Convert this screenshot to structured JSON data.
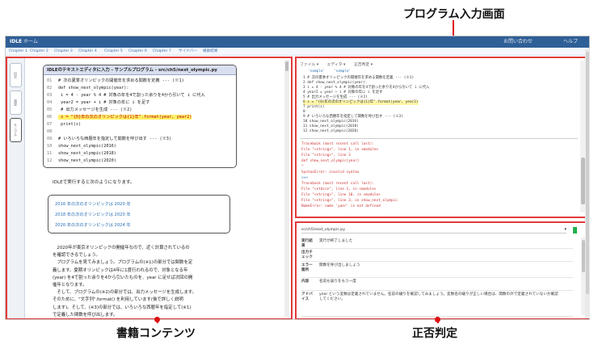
{
  "callouts": {
    "program_input": "プログラム入力画面",
    "book_content": "書籍コンテンツ",
    "judgement": "正否判定"
  },
  "topbar": {
    "logo": "IDLE",
    "title": "ホーム",
    "right1": "お問い合わせ",
    "right2": "ヘルプ"
  },
  "chapters": [
    "Chapter 1",
    "Chapter 2",
    "Chapter 3",
    "Chapter 4",
    "Chapter 5",
    "Chapter 6",
    "Chapter 7",
    "サイドバー",
    "検索結果"
  ],
  "sidetabs": [
    "目次",
    "演習",
    "サンプル"
  ],
  "code": {
    "title": "IDLEのテキストエディタに入力 - サンプルプログラム - src/ch5/next_olympic.py",
    "lines": [
      {
        "n": "01",
        "t": "# 次の夏季オリンピックの開催年を求める関数を定義 --- (※1)",
        "hl": false
      },
      {
        "n": "02",
        "t": "def show_next_olympic(year):",
        "hl": false
      },
      {
        "n": "03",
        "t": "    i = 4 - year % 4  # 対象の年を4で割った余りを4から引いて i に代入",
        "hl": false
      },
      {
        "n": "04",
        "t": "    year2 = year + i  # 対象の年に i を足す",
        "hl": false
      },
      {
        "n": "05",
        "t": "    # 出力メッセージを生成 --- (※2)",
        "hl": false
      },
      {
        "n": "06",
        "t": "    s = \"{0}年の次のオリンピックは{1}年\".format(year, year2)",
        "hl": true
      },
      {
        "n": "07",
        "t": "    print(s)",
        "hl": false
      },
      {
        "n": "08",
        "t": "",
        "hl": false
      },
      {
        "n": "09",
        "t": "# いろいろな西暦年を指定して関数を呼び出す --- (※3)",
        "hl": false
      },
      {
        "n": "10",
        "t": "show_next_olympic(2016)",
        "hl": false
      },
      {
        "n": "11",
        "t": "show_next_olympic(2018)",
        "hl": false
      },
      {
        "n": "12",
        "t": "show_next_olympic(2020)",
        "hl": false
      }
    ]
  },
  "run_text": "IDLEで実行すると次のようになります。",
  "output_lines": [
    "2016 年の次のオリンピックは 2020 年",
    "2018 年の次のオリンピックは 2020 年",
    "2020 年の次のオリンピックは 2024 年"
  ],
  "body_lines": [
    "　2020年が東京オリンピックの開催年なので、近く計算されているの",
    "を確認できるでしょう。",
    "　プログラムを見てみましょう。プログラムの(※1)の部分では関数を定",
    "義します。夏期オリンピックは4年に1度行われるので、対象となる年",
    "(year) を4で割った余りを4から引いたものを、year に足せば次回の開",
    "催年となります。",
    "　そして、プログラムの(※2)の部分では、出力メッセージを生成します。",
    "そのために、\"文字列\".format() を利用しています(後で詳しく説明",
    "します)。そして、(※3)の部分では、いろいろな西暦年を指定して(※1)",
    "で定義した関数を呼び出します。"
  ],
  "editor": {
    "toolbar": [
      "ファイル ▾",
      "エディタ ▾",
      "正否判定 ▾"
    ],
    "header": [
      "'sample'",
      "'sample'"
    ],
    "lines": [
      "1  # 次の夏季オリンピックの開催年を求める関数を定義 --- (※1)",
      "2  def show_next_olympic(year):",
      "3      i = 4 - year % 4 # 対象の年を4で割った余りを4から引いて i に代入",
      "4      year2 = year + i # 対象の年に i を足す",
      "5      # 出力メッセージを生成 --- (※2)",
      "6      s = \"{0}年の次のオリンピックは{1}年\".format(year, year2)",
      "7      print(s)",
      "8  ",
      "9  # いろいろな西暦年を指定して関数を呼び出す --- (※3)",
      "10 show_next_olympic(2016)",
      "11 show_next_olympic(2018)",
      "12 show_next_olympic(2020)"
    ]
  },
  "console_lines": [
    "Traceback (most recent call last):",
    "  File \"<string>\", line 1, in <module>",
    "  File \"<string>\", line 3",
    "    def show_next_olympic(year)",
    "                               ^",
    "SyntaxError: invalid syntax",
    ">>>",
    "Traceback (most recent call last):",
    "  File \"<stdin>\", line 1, in <module>",
    "  File \"<string>\", line 10, in <module>",
    "  File \"<string>\", line 3, in show_next_olympic",
    "NameError: name 'yaer' is not defined"
  ],
  "judge": {
    "select": "sc/ch5/next_olympic.py",
    "rows": [
      {
        "k": "実行結果",
        "v": "実行が終了しました"
      },
      {
        "k": "出力チェック",
        "v": ""
      },
      {
        "k": "エラー箇所",
        "v": "関数を呼び出しましょう"
      },
      {
        "k": "内容",
        "v": "名前も誤りをもう一度"
      },
      {
        "k": "アドバイス",
        "v": "year という変数は定義されていません。名前の綴りを確認してみましょう。変数名の綴りが正しい場合は、関数の外で定義されていないか確認してください。"
      }
    ]
  },
  "colors": {
    "highlight_border": "#e23a3a",
    "header": "#2f5f97",
    "accent_blue": "#2a6fb5",
    "hl_yellow": "#fff066"
  }
}
